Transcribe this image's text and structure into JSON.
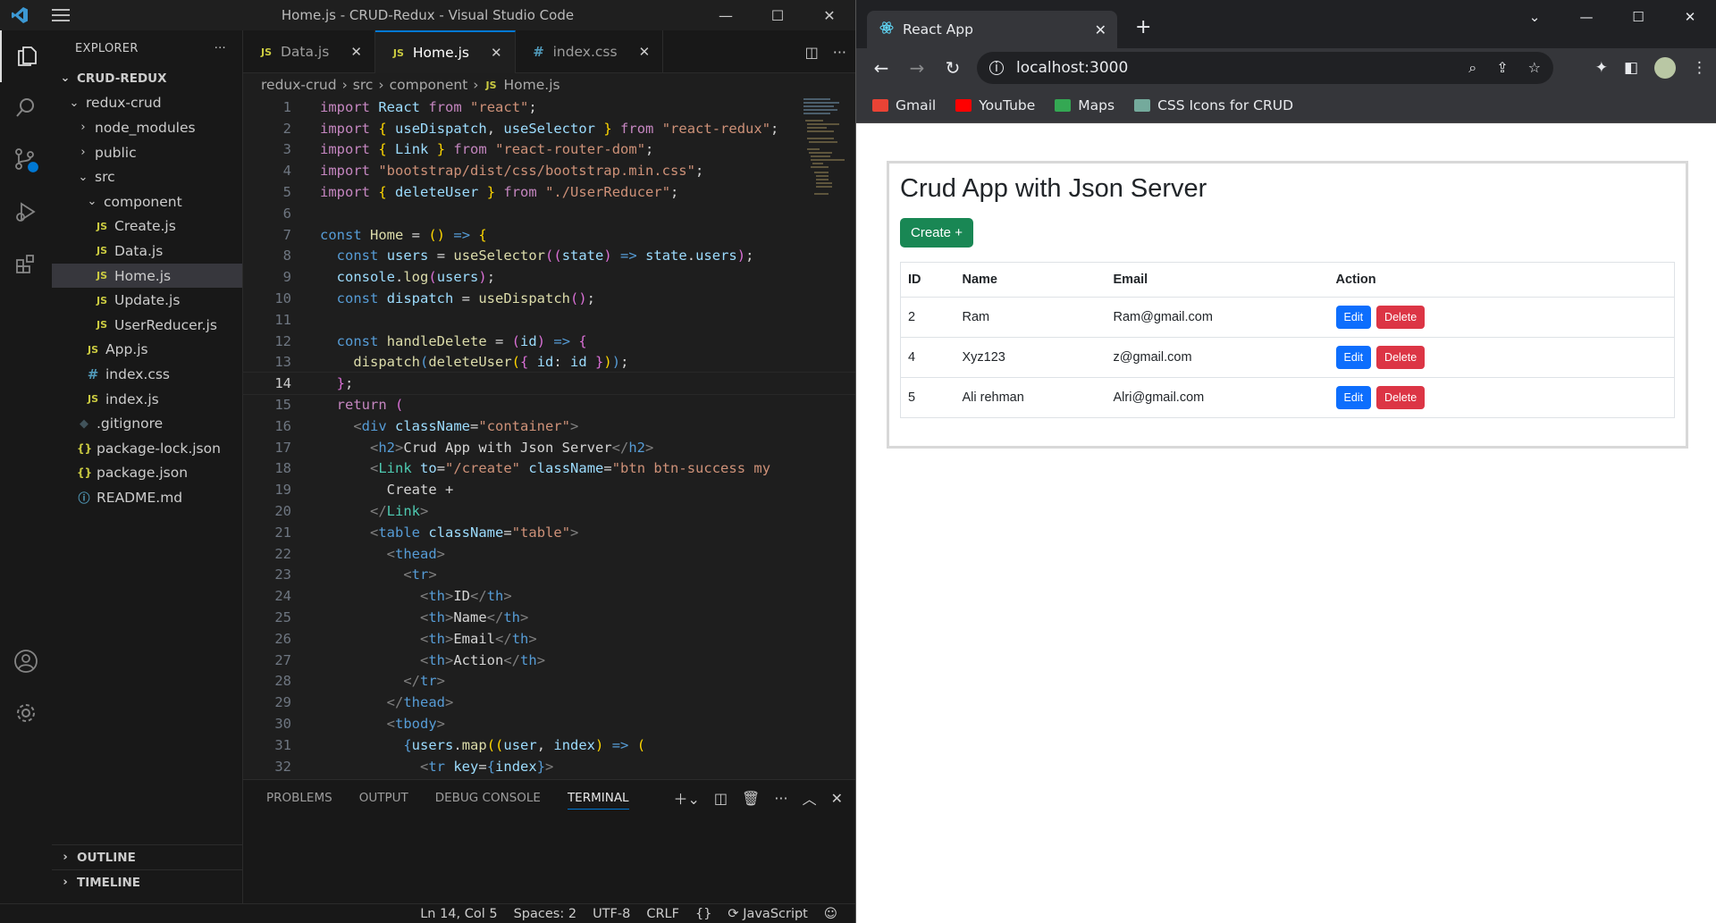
{
  "vscode": {
    "window_title": "Home.js - CRUD-Redux - Visual Studio Code",
    "sidebar": {
      "title": "EXPLORER",
      "more": "···",
      "tree": [
        {
          "label": "CRUD-REDUX",
          "indent": 0,
          "chev": "v",
          "type": "root"
        },
        {
          "label": "redux-crud",
          "indent": 1,
          "chev": "v",
          "type": "folder"
        },
        {
          "label": "node_modules",
          "indent": 2,
          "chev": ">",
          "type": "folder"
        },
        {
          "label": "public",
          "indent": 2,
          "chev": ">",
          "type": "folder"
        },
        {
          "label": "src",
          "indent": 2,
          "chev": "v",
          "type": "folder"
        },
        {
          "label": "component",
          "indent": 3,
          "chev": "v",
          "type": "folder"
        },
        {
          "label": "Create.js",
          "indent": 4,
          "type": "js"
        },
        {
          "label": "Data.js",
          "indent": 4,
          "type": "js"
        },
        {
          "label": "Home.js",
          "indent": 4,
          "type": "js",
          "selected": true
        },
        {
          "label": "Update.js",
          "indent": 4,
          "type": "js"
        },
        {
          "label": "UserReducer.js",
          "indent": 4,
          "type": "js"
        },
        {
          "label": "App.js",
          "indent": 3,
          "type": "js"
        },
        {
          "label": "index.css",
          "indent": 3,
          "type": "css"
        },
        {
          "label": "index.js",
          "indent": 3,
          "type": "js"
        },
        {
          "label": ".gitignore",
          "indent": 2,
          "type": "git"
        },
        {
          "label": "package-lock.json",
          "indent": 2,
          "type": "json"
        },
        {
          "label": "package.json",
          "indent": 2,
          "type": "json"
        },
        {
          "label": "README.md",
          "indent": 2,
          "type": "info"
        }
      ],
      "outline": "OUTLINE",
      "timeline": "TIMELINE"
    },
    "tabs": [
      {
        "label": "Data.js",
        "icon": "JS",
        "active": false
      },
      {
        "label": "Home.js",
        "icon": "JS",
        "active": true
      },
      {
        "label": "index.css",
        "icon": "#",
        "active": false
      }
    ],
    "breadcrumb": [
      "redux-crud",
      "src",
      "component",
      "Home.js"
    ],
    "current_line": 14,
    "code_start_line": 1,
    "panel_tabs": [
      "PROBLEMS",
      "OUTPUT",
      "DEBUG CONSOLE",
      "TERMINAL"
    ],
    "active_panel_tab": "TERMINAL",
    "status": {
      "position": "Ln 14, Col 5",
      "spaces": "Spaces: 2",
      "encoding": "UTF-8",
      "eol": "CRLF",
      "braces": "{}",
      "language": "JavaScript"
    }
  },
  "chrome": {
    "tab_title": "React App",
    "url": "localhost:3000",
    "bookmarks": [
      {
        "label": "Gmail",
        "color": "#ea4335"
      },
      {
        "label": "YouTube",
        "color": "#ff0000"
      },
      {
        "label": "Maps",
        "color": "#34a853"
      },
      {
        "label": "CSS Icons for CRUD",
        "color": "#74aa9c"
      }
    ]
  },
  "app": {
    "title": "Crud App with Json Server",
    "create_label": "Create +",
    "columns": [
      "ID",
      "Name",
      "Email",
      "Action"
    ],
    "rows": [
      {
        "id": "2",
        "name": "Ram",
        "email": "Ram@gmail.com"
      },
      {
        "id": "4",
        "name": "Xyz123",
        "email": "z@gmail.com"
      },
      {
        "id": "5",
        "name": "Ali rehman",
        "email": "Alri@gmail.com"
      }
    ],
    "edit_label": "Edit",
    "delete_label": "Delete",
    "colors": {
      "success": "#198754",
      "primary": "#0d6efd",
      "danger": "#dc3545"
    }
  }
}
